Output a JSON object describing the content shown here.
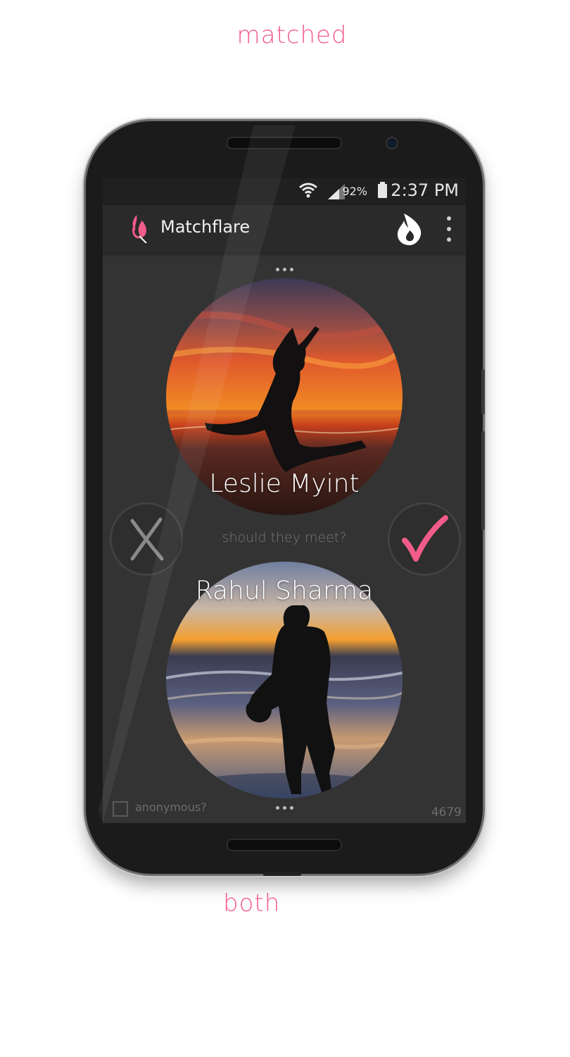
{
  "captions": {
    "top": "matched",
    "bottom": "both"
  },
  "status_bar": {
    "time": "2:37 PM",
    "battery": "92%"
  },
  "app_bar": {
    "title": "Matchflare"
  },
  "profiles": [
    {
      "name": "Leslie Myint"
    },
    {
      "name": "Rahul Sharma"
    }
  ],
  "prompt": "should they meet?",
  "footer": {
    "anonymous_label": "anonymous?",
    "anonymous_checked": false,
    "counter": "4679"
  },
  "icons": {
    "logo": "matchflare-logo-icon",
    "flame": "flame-icon",
    "overflow": "overflow-menu-icon",
    "reject": "x-icon",
    "accept": "checkmark-icon",
    "wifi": "wifi-icon",
    "signal": "signal-icon",
    "battery": "battery-icon"
  },
  "colors": {
    "accent": "#f25c8a",
    "screen_bg": "#333333",
    "appbar_bg": "#2a2a2a",
    "statusbar_bg": "#202020"
  }
}
